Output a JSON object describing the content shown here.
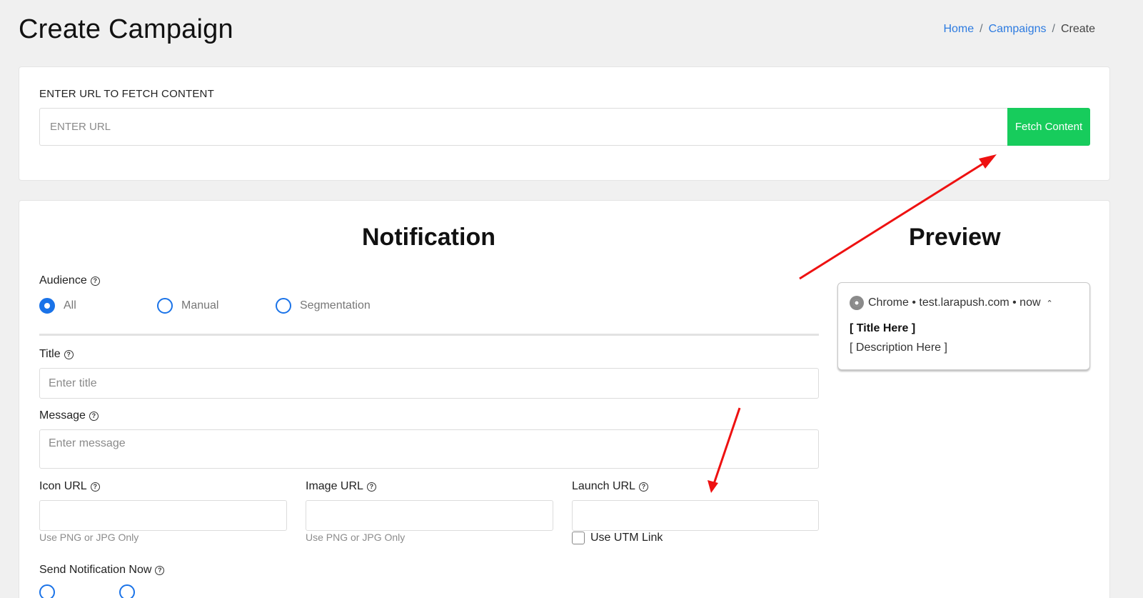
{
  "page": {
    "title": "Create Campaign",
    "breadcrumb": {
      "home": "Home",
      "campaigns": "Campaigns",
      "current": "Create",
      "separator": "/"
    }
  },
  "fetch": {
    "label": "ENTER URL TO FETCH CONTENT",
    "placeholder": "ENTER URL",
    "button": "Fetch Content"
  },
  "notification": {
    "heading": "Notification",
    "audience": {
      "label": "Audience",
      "options": [
        "All",
        "Manual",
        "Segmentation"
      ],
      "selected": "All"
    },
    "title": {
      "label": "Title",
      "placeholder": "Enter title"
    },
    "message": {
      "label": "Message",
      "placeholder": "Enter message"
    },
    "icon_url": {
      "label": "Icon URL",
      "hint": "Use PNG or JPG Only"
    },
    "image_url": {
      "label": "Image URL",
      "hint": "Use PNG or JPG Only"
    },
    "launch_url": {
      "label": "Launch URL",
      "utm_label": "Use UTM Link"
    },
    "send_now": {
      "label": "Send Notification Now"
    }
  },
  "preview": {
    "heading": "Preview",
    "source": "Chrome • test.larapush.com • now",
    "title": "[ Title Here ]",
    "description": "[ Description Here ]"
  },
  "colors": {
    "accent": "#1a73e8",
    "fetch_button": "#17cc5c",
    "link": "#2d7be0",
    "annotation_arrow": "#ee1111"
  }
}
